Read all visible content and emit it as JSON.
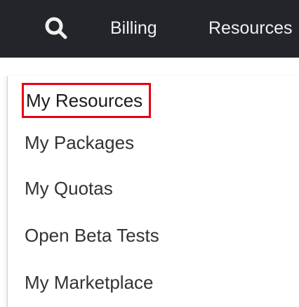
{
  "nav": {
    "search_icon": "search-icon",
    "billing_label": "Billing",
    "resources_label": "Resources"
  },
  "menu": {
    "items": [
      {
        "label": "My Resources"
      },
      {
        "label": "My Packages"
      },
      {
        "label": "My Quotas"
      },
      {
        "label": "Open Beta Tests"
      },
      {
        "label": "My Marketplace"
      }
    ]
  },
  "colors": {
    "topbar_bg": "#23252a",
    "highlight_border": "#e60012",
    "menu_text": "#333333"
  }
}
